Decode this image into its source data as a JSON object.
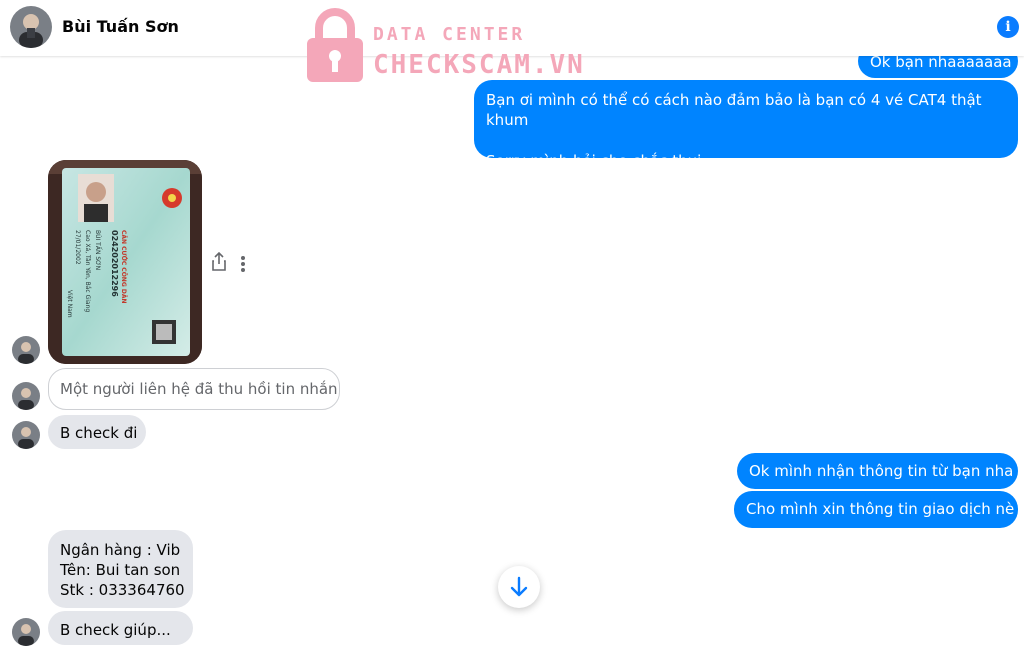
{
  "header": {
    "contact_name": "Bùi Tuấn Sơn",
    "info_icon": "info-icon"
  },
  "watermark": {
    "line1": "DATA CENTER",
    "line2": "CHECKSCAM.VN",
    "icon": "lock-icon"
  },
  "messages": {
    "out_top": "Ok bạn nhaaaaaaa",
    "out_1_line1": "Bạn ơi mình có thể có cách nào đảm bảo là bạn có 4 vé CAT4 thật khum",
    "out_1_line2": "Sorry mình hỏi cho chắc thui",
    "recalled": "Một người liên hệ đã thu hồi tin nhắn",
    "in_1": "B check đi",
    "out_2": "Ok mình nhận thông tin từ bạn nha",
    "out_3": "Cho mình xin thông tin giao dịch nè",
    "in_2_line1": "Ngân hàng : Vib",
    "in_2_line2": "Tên: Bui tan son",
    "in_2_line3": "Stk : 033364760",
    "in_3_partial": "B check giúp..."
  },
  "id_card": {
    "title": "CĂN CƯỚC CÔNG DÂN",
    "number": "024202012296",
    "name": "BÙI TẤN SƠN",
    "dob": "27/01/2002",
    "origin": "Cao Xá, Tân Yên, Bắc Giang",
    "nationality": "Việt Nam"
  },
  "icons": {
    "share": "share-icon",
    "more": "more-options-icon",
    "scroll_down": "arrow-down-icon"
  },
  "colors": {
    "outgoing": "#0084ff",
    "incoming": "#e4e6eb",
    "accent": "#0a7cff",
    "watermark": "#f4a7b9"
  }
}
